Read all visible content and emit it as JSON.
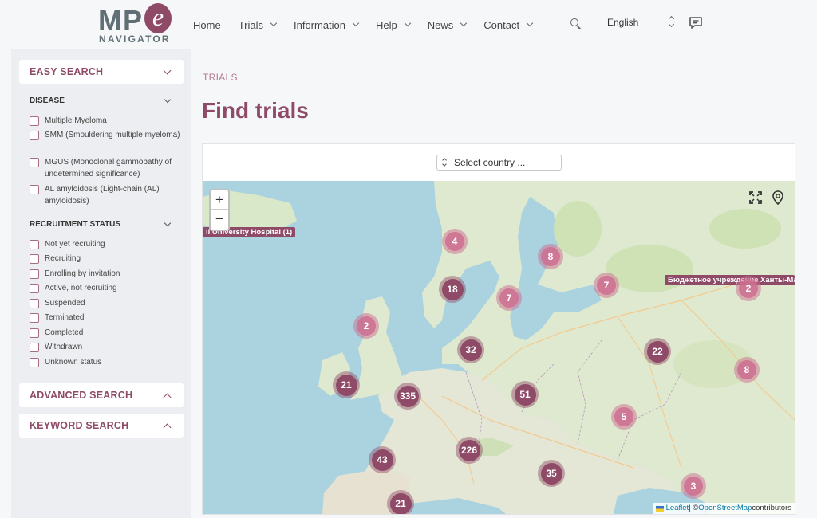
{
  "header": {
    "logo_text": "MP",
    "logo_e": "e",
    "logo_sub": "NAVIGATOR",
    "nav": [
      {
        "label": "Home"
      },
      {
        "label": "Trials"
      },
      {
        "label": "Information"
      },
      {
        "label": "Help"
      },
      {
        "label": "News"
      },
      {
        "label": "Contact"
      }
    ],
    "language": "English"
  },
  "sidebar": {
    "easy_search": "EASY SEARCH",
    "disease": {
      "heading": "DISEASE",
      "items": [
        "Multiple Myeloma",
        "SMM (Smouldering multiple myeloma)",
        "MGUS (Monoclonal gammopathy of undetermined significance)",
        "AL amyloidosis (Light-chain (AL) amyloidosis)"
      ]
    },
    "recruitment": {
      "heading": "RECRUITMENT STATUS",
      "items": [
        "Not yet recruiting",
        "Recruiting",
        "Enrolling by invitation",
        "Active, not recruiting",
        "Suspended",
        "Terminated",
        "Completed",
        "Withdrawn",
        "Unknown status"
      ]
    },
    "advanced_search": "ADVANCED SEARCH",
    "keyword_search": "KEYWORD SEARCH"
  },
  "main": {
    "breadcrumb": "TRIALS",
    "title": "Find trials",
    "country_select": "Select country ..."
  },
  "map": {
    "clusters": [
      {
        "count": "4",
        "style": "small"
      },
      {
        "count": "8",
        "style": "small"
      },
      {
        "count": "18",
        "style": "big"
      },
      {
        "count": "7",
        "style": "small"
      },
      {
        "count": "7",
        "style": "small"
      },
      {
        "count": "2",
        "style": "small"
      },
      {
        "count": "2",
        "style": "small"
      },
      {
        "count": "32",
        "style": "big"
      },
      {
        "count": "22",
        "style": "big"
      },
      {
        "count": "8",
        "style": "small"
      },
      {
        "count": "21",
        "style": "big"
      },
      {
        "count": "335",
        "style": "big"
      },
      {
        "count": "51",
        "style": "big"
      },
      {
        "count": "5",
        "style": "small"
      },
      {
        "count": "43",
        "style": "big"
      },
      {
        "count": "226",
        "style": "big"
      },
      {
        "count": "35",
        "style": "big"
      },
      {
        "count": "3",
        "style": "small"
      },
      {
        "count": "21",
        "style": "big"
      }
    ],
    "labels": [
      "li University Hospital (1)",
      "Бюджетное учреждение Ханты-Ма"
    ],
    "zoom_in": "+",
    "zoom_out": "−",
    "attribution_leaflet": "Leaflet",
    "attribution_sep": " | © ",
    "attribution_osm": "OpenStreetMap",
    "attribution_rest": " contributors"
  }
}
